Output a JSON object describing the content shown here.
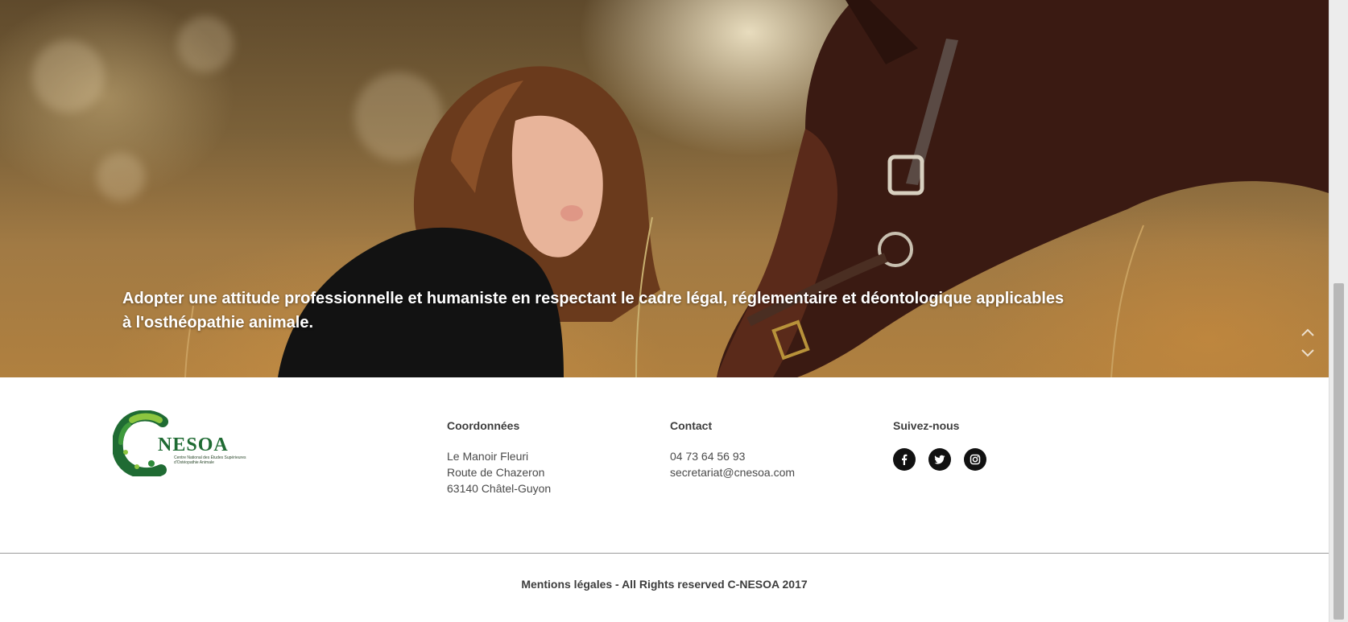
{
  "hero": {
    "caption": "Adopter une attitude professionnelle et humaniste en respectant le cadre légal, réglementaire et déontologique applicables à l'osthéopathie animale.",
    "controls": {
      "up_icon": "chevron-up-icon",
      "down_icon": "chevron-down-icon"
    }
  },
  "logo": {
    "brand": "NESOA",
    "tagline_1": "Centre National des Études Supérieures",
    "tagline_2": "d'Ostéopathie Animale",
    "colors": [
      "#1f6b33",
      "#3e9a3c",
      "#8cc63f"
    ]
  },
  "footer": {
    "address": {
      "title": "Coordonnées",
      "lines": [
        "Le Manoir Fleuri",
        "Route de Chazeron",
        "63140 Châtel-Guyon"
      ]
    },
    "contact": {
      "title": "Contact",
      "phone": "04 73 64 56 93",
      "email": "secretariat@cnesoa.com"
    },
    "social": {
      "title": "Suivez-nous",
      "icons": [
        "facebook-icon",
        "twitter-icon",
        "instagram-icon"
      ]
    },
    "copyright": "Mentions légales - All Rights reserved C-NESOA 2017"
  },
  "colors": {
    "brand_dark": "#1f6b33",
    "brand_light": "#8cc63f",
    "text": "#3d3d3d"
  }
}
